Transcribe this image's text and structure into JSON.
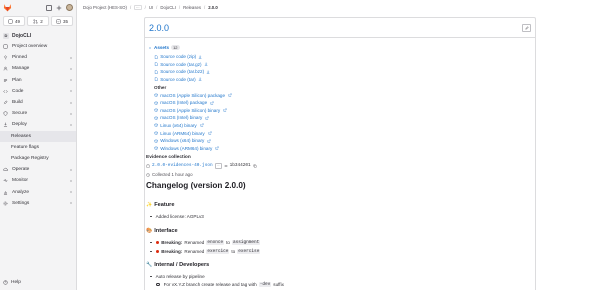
{
  "sidebar": {
    "counters": [
      "49",
      "2",
      "35"
    ],
    "project_badge": "D",
    "project_name": "DojoCLI",
    "items": [
      {
        "label": "Project overview",
        "icon": "project-icon"
      },
      {
        "label": "Pinned",
        "icon": "pin-icon",
        "chevron": true
      },
      {
        "label": "Manage",
        "icon": "users-icon",
        "chevron": true
      },
      {
        "label": "Plan",
        "icon": "plan-icon",
        "chevron": true
      },
      {
        "label": "Code",
        "icon": "code-icon",
        "chevron": true
      },
      {
        "label": "Build",
        "icon": "rocket-icon",
        "chevron": true
      },
      {
        "label": "Secure",
        "icon": "shield-icon",
        "chevron": true
      },
      {
        "label": "Deploy",
        "icon": "deploy-icon",
        "chevron": true
      }
    ],
    "deploy_sub": [
      "Releases",
      "Feature flags",
      "Package Registry"
    ],
    "items_after": [
      {
        "label": "Operate",
        "icon": "cloud-icon",
        "chevron": true
      },
      {
        "label": "Monitor",
        "icon": "monitor-icon",
        "chevron": true
      },
      {
        "label": "Analyze",
        "icon": "chart-icon",
        "chevron": true
      },
      {
        "label": "Settings",
        "icon": "gear-icon",
        "chevron": true
      }
    ],
    "help": "Help"
  },
  "breadcrumb": {
    "items": [
      "Dojo Project (HES-SO)",
      "…",
      "UI",
      "DojoCLI",
      "Releases",
      "2.0.0"
    ]
  },
  "release": {
    "version": "2.0.0",
    "assets_label": "Assets",
    "assets_count": "12",
    "source_links": [
      "Source code (zip)",
      "Source code (tar.gz)",
      "Source code (tar.bz2)",
      "Source code (tar)"
    ],
    "other_label": "Other",
    "other_links": [
      "macOS (Apple Silicon) package",
      "macOS (Intel) package",
      "macOS (Apple Silicon) binary",
      "macOS (Intel) binary",
      "Linux (x64) binary",
      "Linux (ARM64) binary",
      "Windows (x64) binary",
      "Windows (ARM64) binary"
    ],
    "evidence_title": "Evidence collection",
    "evidence_file": "2.0.0-evidences-40.json",
    "evidence_more": "…",
    "evidence_sha": "1b344201",
    "collected": "Collected 1 hour ago",
    "changelog_title": "Changelog (version 2.0.0)",
    "feature_heading": "Feature",
    "feature_emoji": "✨",
    "feature_items": [
      "Added license: AGPLv3"
    ],
    "interface_heading": "Interface",
    "interface_emoji": "🎨",
    "interface_items": [
      {
        "badge": "Breaking:",
        "pre": "Renamed",
        "code1": "enonce",
        "mid": "to",
        "code2": "assignment"
      },
      {
        "badge": "Breaking:",
        "pre": "Renamed",
        "code1": "exercice",
        "mid": "to",
        "code2": "exercise"
      }
    ],
    "internal_heading": "Internal / Developers",
    "internal_emoji": "🔧",
    "internal_items": [
      "Auto release by pipeline"
    ],
    "internal_sub": {
      "pre": "For vX.Y.Z branch create release and tag with",
      "code": "-dev",
      "post": "suffix"
    }
  },
  "colors": {
    "link": "#1f75cb",
    "breaking": "#dd2b0e",
    "sidebar_bg": "#f4f4f5"
  }
}
